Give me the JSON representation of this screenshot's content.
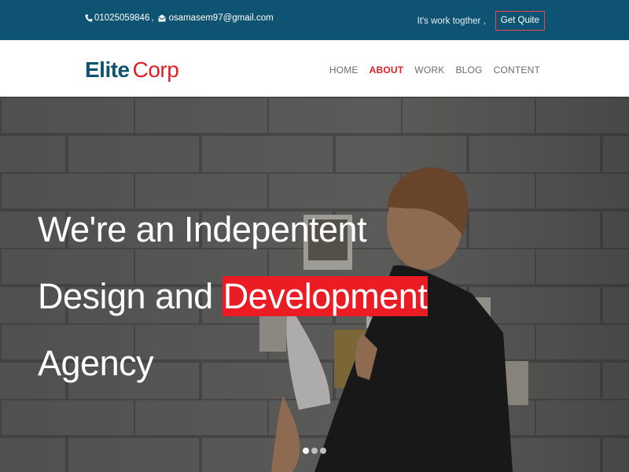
{
  "topbar": {
    "phone": "01025059846",
    "separator": ",",
    "email": "osamasem97@gmail.com",
    "tagline": "It's work togther ,",
    "quote_button": "Get Quite",
    "phone_icon": "phone-icon",
    "email_icon": "envelope-icon"
  },
  "brand": {
    "name_part1": "Elite",
    "name_part2": "Corp"
  },
  "nav": {
    "items": [
      {
        "label": "HOME",
        "active": false
      },
      {
        "label": "ABOUT",
        "active": true
      },
      {
        "label": "WORK",
        "active": false
      },
      {
        "label": "BLOG",
        "active": false
      },
      {
        "label": "CONTENT",
        "active": false
      }
    ]
  },
  "hero": {
    "line1": "We're an Indepentent",
    "line2_plain": "Design and",
    "line2_highlight": "Development",
    "line3": "Agency",
    "slider_dots": 3,
    "active_slide": 1
  },
  "colors": {
    "topbar_bg": "#0e5472",
    "accent_red": "#e31e24",
    "highlight_red": "#ec1c24",
    "nav_text": "#6b6b6b"
  }
}
